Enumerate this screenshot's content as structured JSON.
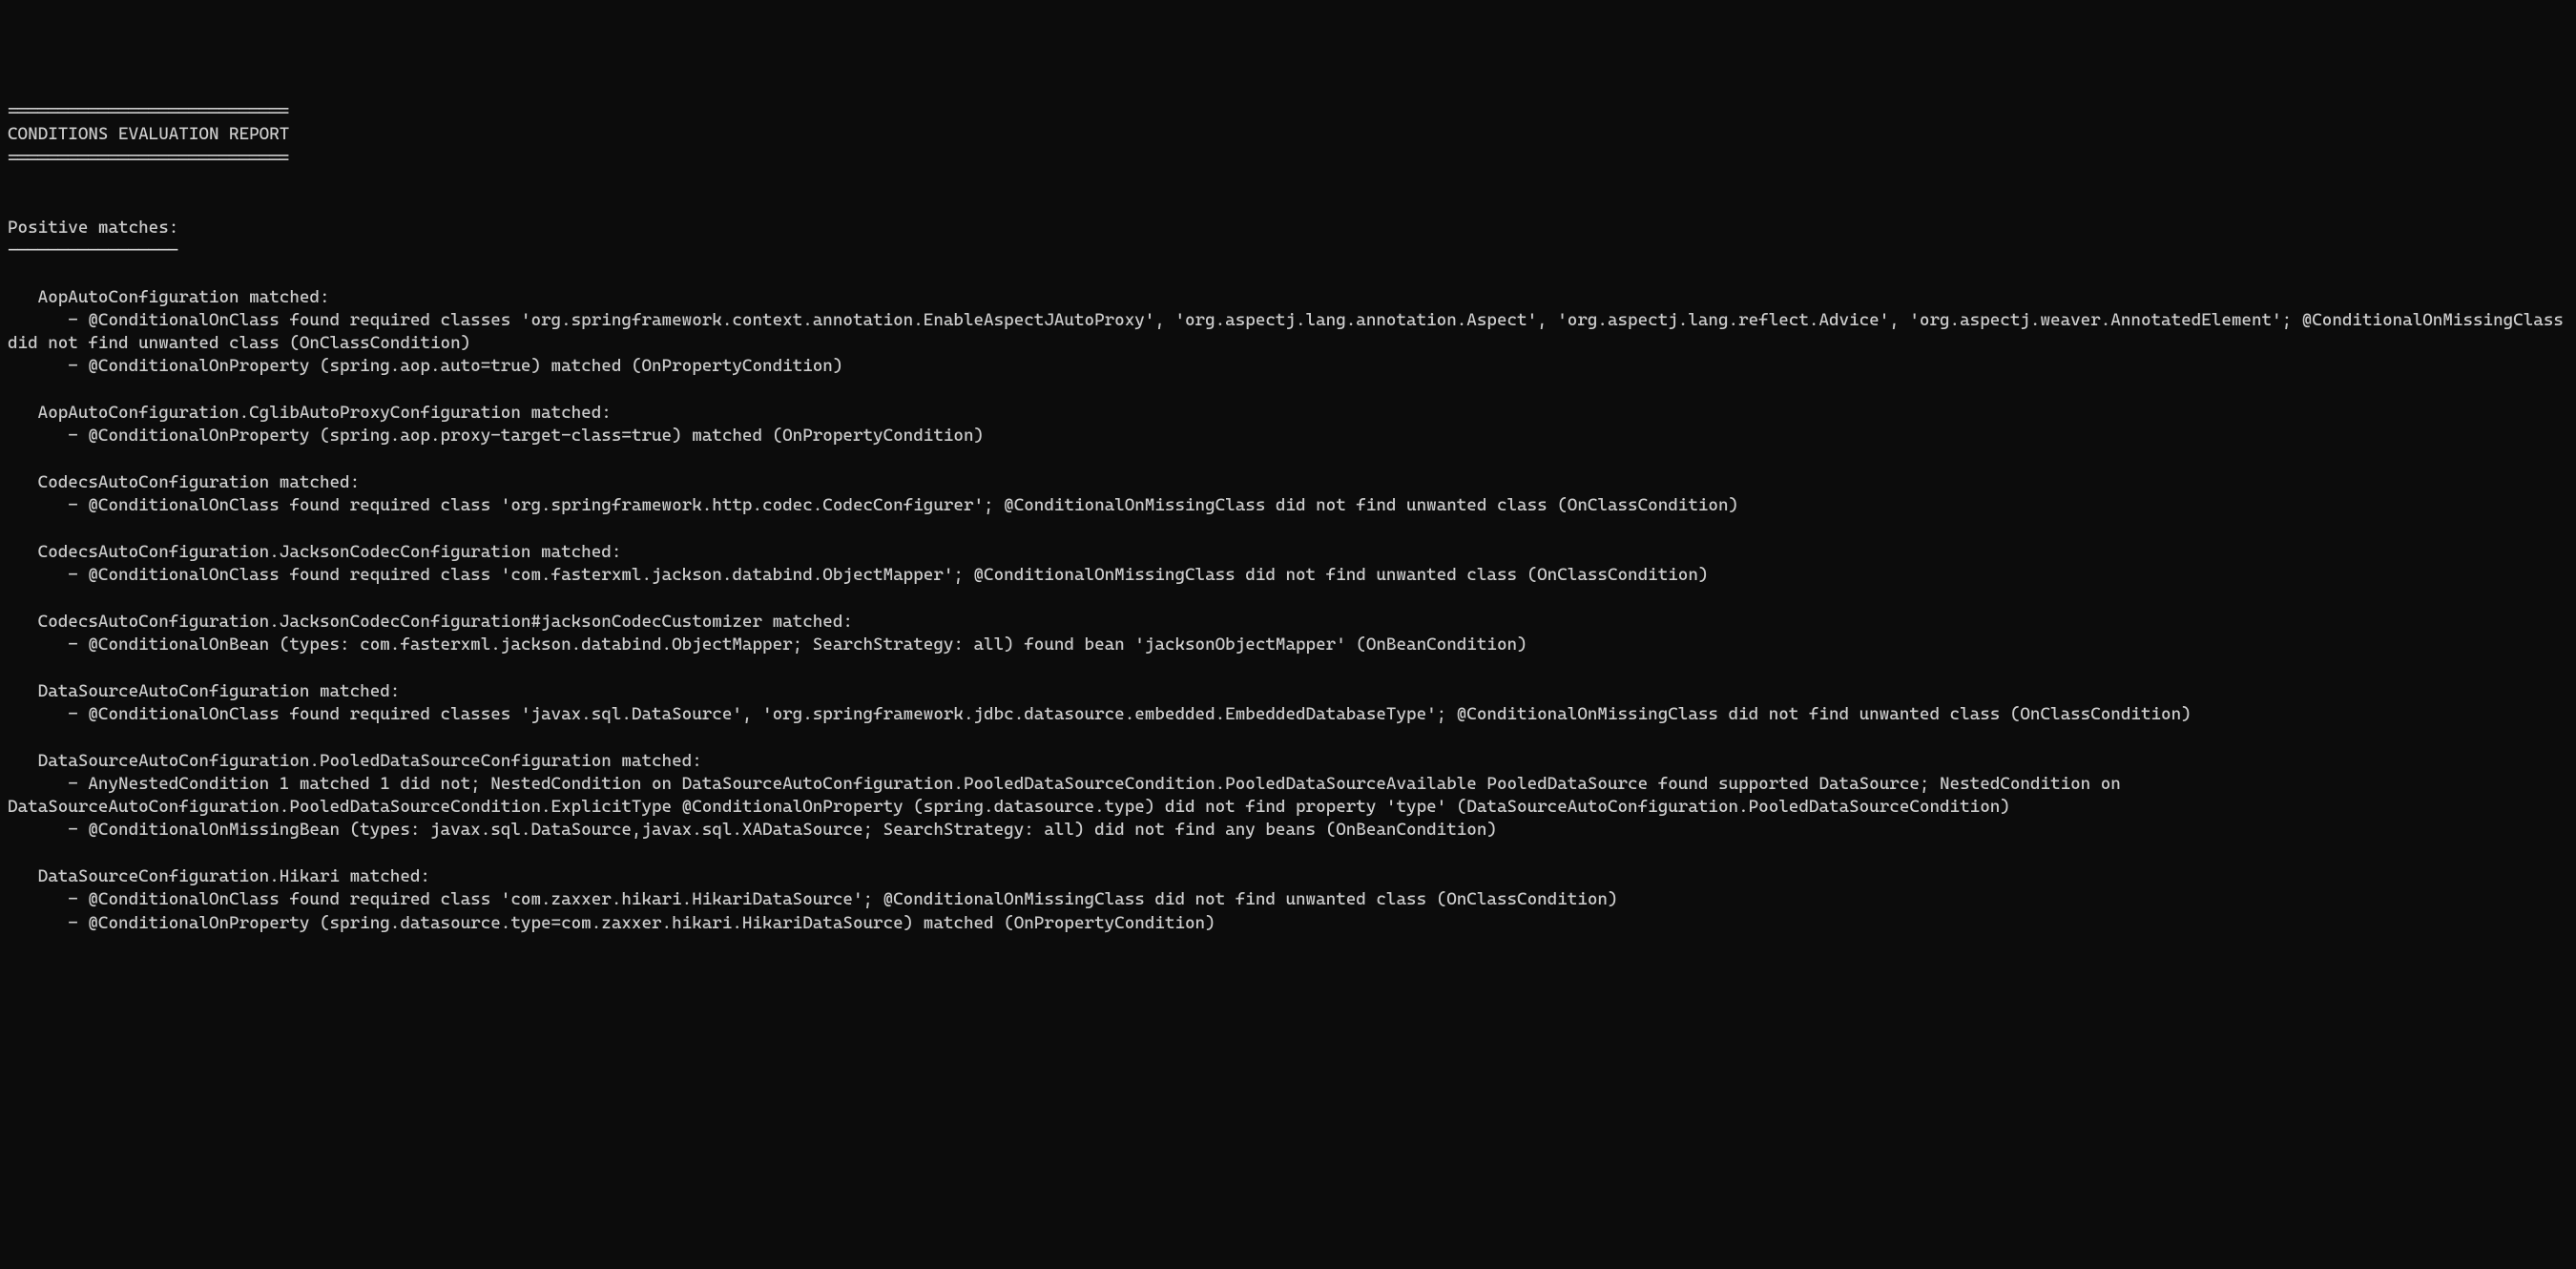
{
  "header": {
    "divider": "============================",
    "title": "CONDITIONS EVALUATION REPORT",
    "divider2": "============================"
  },
  "section": {
    "title": "Positive matches:",
    "underline": "-----------------"
  },
  "matches": [
    {
      "name": "AopAutoConfiguration matched:",
      "conditions": [
        "- @ConditionalOnClass found required classes 'org.springframework.context.annotation.EnableAspectJAutoProxy', 'org.aspectj.lang.annotation.Aspect', 'org.aspectj.lang.reflect.Advice', 'org.aspectj.weaver.AnnotatedElement'; @ConditionalOnMissingClass did not find unwanted class (OnClassCondition)",
        "- @ConditionalOnProperty (spring.aop.auto=true) matched (OnPropertyCondition)"
      ]
    },
    {
      "name": "AopAutoConfiguration.CglibAutoProxyConfiguration matched:",
      "conditions": [
        "- @ConditionalOnProperty (spring.aop.proxy-target-class=true) matched (OnPropertyCondition)"
      ]
    },
    {
      "name": "CodecsAutoConfiguration matched:",
      "conditions": [
        "- @ConditionalOnClass found required class 'org.springframework.http.codec.CodecConfigurer'; @ConditionalOnMissingClass did not find unwanted class (OnClassCondition)"
      ]
    },
    {
      "name": "CodecsAutoConfiguration.JacksonCodecConfiguration matched:",
      "conditions": [
        "- @ConditionalOnClass found required class 'com.fasterxml.jackson.databind.ObjectMapper'; @ConditionalOnMissingClass did not find unwanted class (OnClassCondition)"
      ]
    },
    {
      "name": "CodecsAutoConfiguration.JacksonCodecConfiguration#jacksonCodecCustomizer matched:",
      "conditions": [
        "- @ConditionalOnBean (types: com.fasterxml.jackson.databind.ObjectMapper; SearchStrategy: all) found bean 'jacksonObjectMapper' (OnBeanCondition)"
      ]
    },
    {
      "name": "DataSourceAutoConfiguration matched:",
      "conditions": [
        "- @ConditionalOnClass found required classes 'javax.sql.DataSource', 'org.springframework.jdbc.datasource.embedded.EmbeddedDatabaseType'; @ConditionalOnMissingClass did not find unwanted class (OnClassCondition)"
      ]
    },
    {
      "name": "DataSourceAutoConfiguration.PooledDataSourceConfiguration matched:",
      "conditions": [
        "- AnyNestedCondition 1 matched 1 did not; NestedCondition on DataSourceAutoConfiguration.PooledDataSourceCondition.PooledDataSourceAvailable PooledDataSource found supported DataSource; NestedCondition on DataSourceAutoConfiguration.PooledDataSourceCondition.ExplicitType @ConditionalOnProperty (spring.datasource.type) did not find property 'type' (DataSourceAutoConfiguration.PooledDataSourceCondition)",
        "- @ConditionalOnMissingBean (types: javax.sql.DataSource,javax.sql.XADataSource; SearchStrategy: all) did not find any beans (OnBeanCondition)"
      ]
    },
    {
      "name": "DataSourceConfiguration.Hikari matched:",
      "conditions": [
        "- @ConditionalOnClass found required class 'com.zaxxer.hikari.HikariDataSource'; @ConditionalOnMissingClass did not find unwanted class (OnClassCondition)",
        "- @ConditionalOnProperty (spring.datasource.type=com.zaxxer.hikari.HikariDataSource) matched (OnPropertyCondition)"
      ]
    }
  ]
}
